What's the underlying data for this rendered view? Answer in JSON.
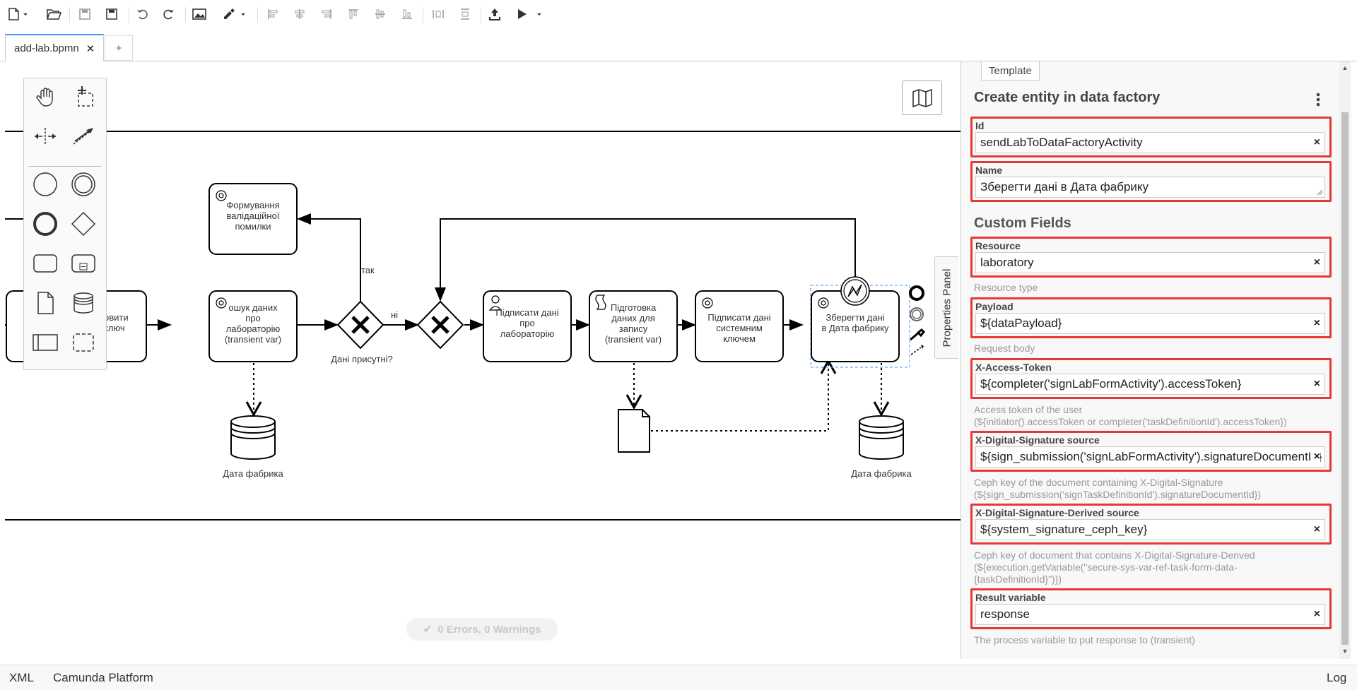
{
  "tabs": [
    {
      "label": "add-lab.bpmn",
      "close": "✕"
    }
  ],
  "add_tab_label": "+",
  "diagram": {
    "tasks": {
      "validation_error": "Формування\nвалідаційної\nпомилки",
      "left_cut": "овити\nключ",
      "search_data": "ошук даних\nпро\nлабораторію\n(transient var)",
      "sign_data": "Підписати дані\nпро\nлабораторію",
      "prepare_data": "Підготовка\nданих для\nзапису\n(transient var)",
      "system_sign": "Підписати дані\nсистемним\nключем",
      "save_data": "Зберегти дані\nв Дата фабрику"
    },
    "gateway_label": "Дані присутні?",
    "flow_yes": "так",
    "flow_no": "ні",
    "datastore_left": "Дата фабрика",
    "datastore_right": "Дата фабрика"
  },
  "properties_panel_toggle": "Properties Panel",
  "status": "0 Errors, 0 Warnings",
  "panel": {
    "template_tab": "Template",
    "title": "Create entity in data factory",
    "custom_fields_title": "Custom Fields",
    "fields": {
      "id": {
        "label": "Id",
        "value": "sendLabToDataFactoryActivity"
      },
      "name": {
        "label": "Name",
        "value": "Зберегти дані в Дата фабрику"
      },
      "resource": {
        "label": "Resource",
        "value": "laboratory",
        "description": "Resource type"
      },
      "payload": {
        "label": "Payload",
        "value": "${dataPayload}",
        "description": "Request body"
      },
      "access_token": {
        "label": "X-Access-Token",
        "value": "${completer('signLabFormActivity').accessToken}",
        "description": "Access token of the user\n(${initiator().accessToken or completer('taskDefinitionId').accessToken})"
      },
      "signature_source": {
        "label": "X-Digital-Signature source",
        "value": "${sign_submission('signLabFormActivity').signatureDocumentId}",
        "description": "Ceph key of the document containing X-Digital-Signature\n(${sign_submission('signTaskDefinitionId').signatureDocumentId})"
      },
      "signature_derived": {
        "label": "X-Digital-Signature-Derived source",
        "value": "${system_signature_ceph_key}",
        "description": "Ceph key of document that contains X-Digital-Signature-Derived\n(${execution.getVariable(\"secure-sys-var-ref-task-form-data-\n{taskDefinitionId}\")})"
      },
      "result_variable": {
        "label": "Result variable",
        "value": "response",
        "description": "The process variable to put response to (transient)"
      }
    }
  },
  "bottom": {
    "xml": "XML",
    "platform": "Camunda Platform",
    "log": "Log"
  }
}
